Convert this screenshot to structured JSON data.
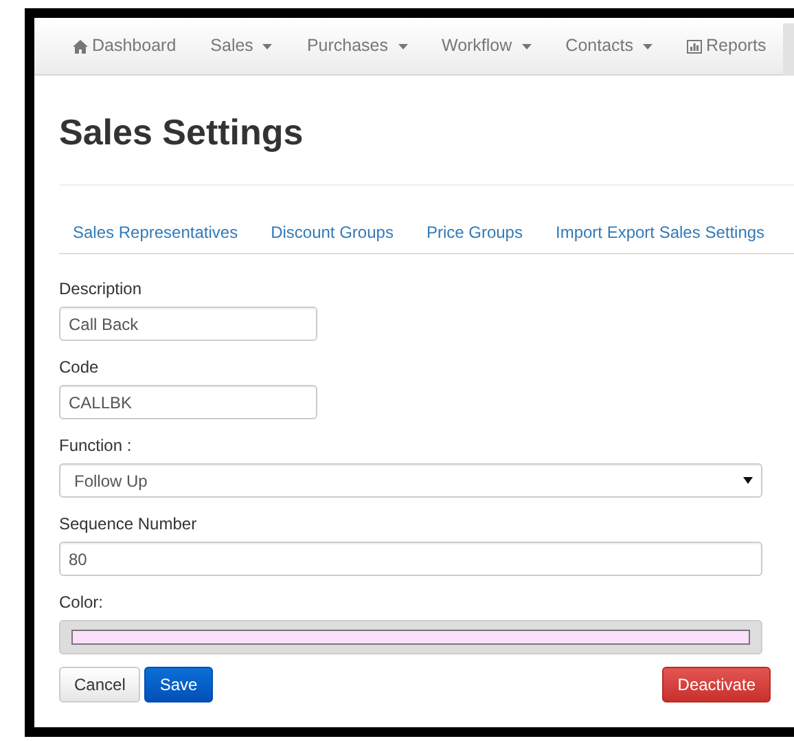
{
  "navbar": {
    "items": [
      {
        "label": "Dashboard",
        "dropdown": false
      },
      {
        "label": "Sales",
        "dropdown": true
      },
      {
        "label": "Purchases",
        "dropdown": true
      },
      {
        "label": "Workflow",
        "dropdown": true
      },
      {
        "label": "Contacts",
        "dropdown": true
      },
      {
        "label": "Reports",
        "dropdown": false
      }
    ]
  },
  "title": "Sales Settings",
  "tabs": [
    {
      "label": "Sales Representatives"
    },
    {
      "label": "Discount Groups"
    },
    {
      "label": "Price Groups"
    },
    {
      "label": "Import Export Sales Settings"
    }
  ],
  "form": {
    "fields": [
      {
        "kind": "text",
        "label": "Description",
        "value": "Call Back",
        "short": true
      },
      {
        "kind": "text",
        "label": "Code",
        "value": "CALLBK",
        "short": true
      },
      {
        "kind": "select",
        "label": "Function :",
        "value": "Follow Up"
      },
      {
        "kind": "text",
        "label": "Sequence Number",
        "value": "80",
        "short": false
      },
      {
        "kind": "color",
        "label": "Color:",
        "color": "#fbdffb"
      }
    ]
  },
  "buttons": [
    {
      "label": "Cancel",
      "kind": "default"
    },
    {
      "label": "Save",
      "kind": "primary"
    },
    {
      "label": "Deactivate",
      "kind": "danger"
    }
  ]
}
